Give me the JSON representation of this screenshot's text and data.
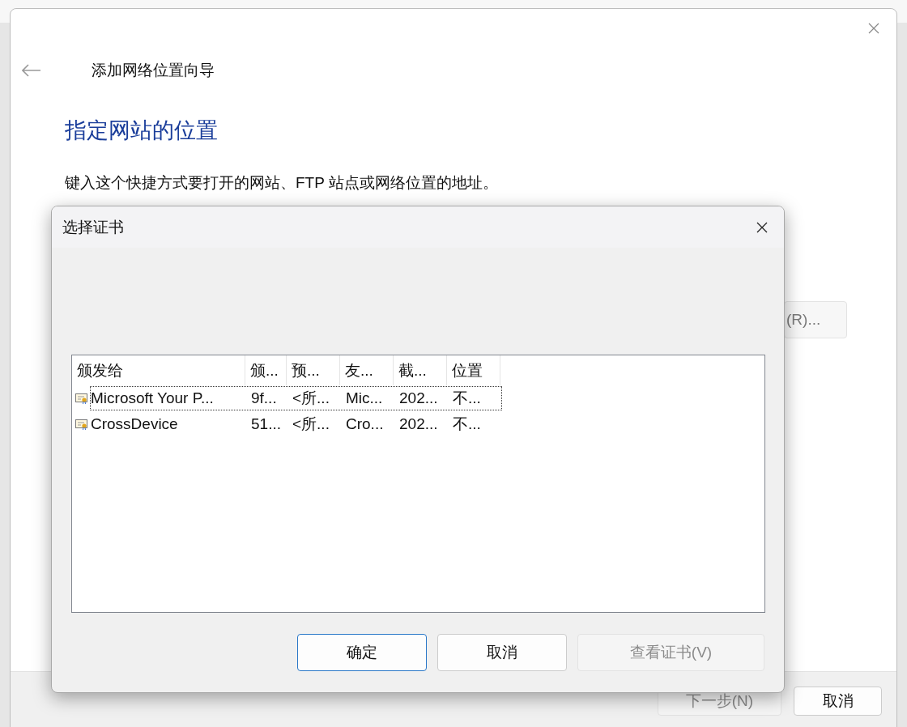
{
  "wizard": {
    "title": "添加网络位置向导",
    "heading": "指定网站的位置",
    "description": "键入这个快捷方式要打开的网站、FTP 站点或网络位置的地址。",
    "browse_button": {
      "label": "(R)..."
    },
    "buttons": [
      {
        "label": "下一步(N)",
        "disabled": true
      },
      {
        "label": "取消",
        "disabled": false
      }
    ]
  },
  "dialog": {
    "title": "选择证书",
    "table": {
      "columns": [
        "颁发给",
        "颁...",
        "预...",
        "友...",
        "截...",
        "位置"
      ],
      "rows": [
        {
          "cells": [
            "Microsoft Your P...",
            "9f...",
            "<所...",
            "Mic...",
            "202...",
            "不..."
          ],
          "selected": true
        },
        {
          "cells": [
            "CrossDevice",
            "51...",
            "<所...",
            "Cro...",
            "202...",
            "不..."
          ],
          "selected": false
        }
      ]
    },
    "buttons": [
      {
        "label": "确定",
        "default": true,
        "disabled": false
      },
      {
        "label": "取消",
        "default": false,
        "disabled": false
      },
      {
        "label": "查看证书(V)",
        "default": false,
        "disabled": true
      }
    ]
  }
}
